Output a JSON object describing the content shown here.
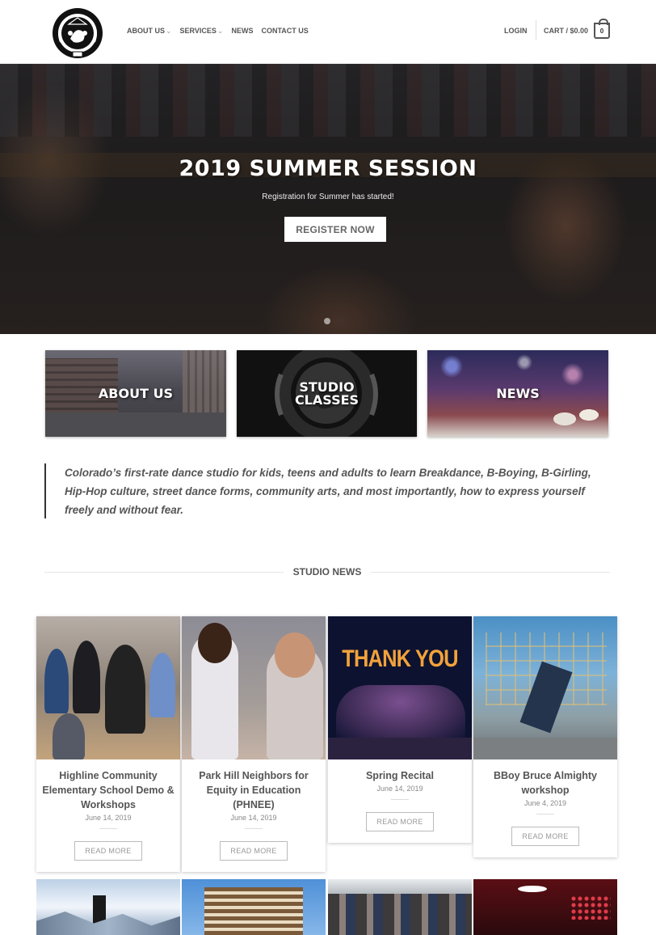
{
  "header": {
    "logo_alt": "Dance studio crest logo",
    "nav": [
      {
        "label": "ABOUT US",
        "has_dropdown": true
      },
      {
        "label": "SERVICES",
        "has_dropdown": true
      },
      {
        "label": "NEWS",
        "has_dropdown": false
      },
      {
        "label": "CONTACT US",
        "has_dropdown": false
      }
    ],
    "login": "LOGIN",
    "cart_label": "CART / $0.00",
    "cart_count": "0"
  },
  "hero": {
    "title": "2019 SUMMER SESSION",
    "subtitle": "Registration for Summer has started!",
    "button": "REGISTER NOW"
  },
  "tiles": [
    {
      "label": "ABOUT US"
    },
    {
      "label_line1": "STUDIO",
      "label_line2": "CLASSES"
    },
    {
      "label": "NEWS"
    }
  ],
  "quote": "Colorado’s first-rate dance studio for kids, teens and adults to learn Breakdance, B-Boying, B-Girling, Hip-Hop culture, street dance forms, community arts, and most importantly, how to express yourself freely and without fear.",
  "section_title": "STUDIO NEWS",
  "news": [
    {
      "title": "Highline Community Elementary School Demo & Workshops",
      "date": "June 14, 2019",
      "button": "READ MORE"
    },
    {
      "title": "Park Hill Neighbors for Equity in Education (PHNEE)",
      "date": "June 14, 2019",
      "button": "READ MORE"
    },
    {
      "title": "Spring Recital",
      "date": "June 14, 2019",
      "button": "READ MORE",
      "image_text": "THANK YOU"
    },
    {
      "title": "BBoy Bruce Almighty workshop",
      "date": "June 4, 2019",
      "button": "READ MORE"
    }
  ],
  "colors": {
    "accent": "#555555",
    "hero_button_text": "#666666"
  }
}
